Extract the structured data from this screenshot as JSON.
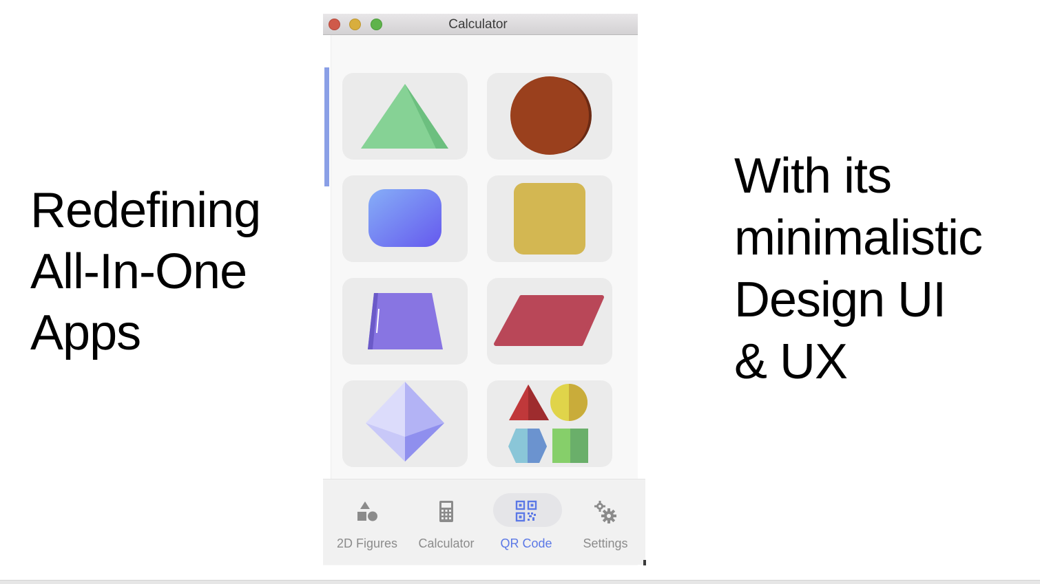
{
  "slide": {
    "left_heading": [
      "Redefining",
      "All-In-One",
      "Apps"
    ],
    "right_heading": [
      "With its",
      "minimalistic",
      "Design UI",
      "& UX"
    ]
  },
  "window": {
    "title": "Calculator",
    "traffic_lights": [
      "close",
      "minimize",
      "zoom"
    ]
  },
  "shapes": [
    {
      "name": "triangle-icon",
      "color": "#86d295"
    },
    {
      "name": "circle-icon",
      "color": "#9a401d"
    },
    {
      "name": "rounded-rectangle-icon",
      "color": "#6a74ee"
    },
    {
      "name": "square-icon",
      "color": "#d3b752"
    },
    {
      "name": "trapezoid-icon",
      "color": "#8875e2"
    },
    {
      "name": "parallelogram-icon",
      "color": "#b94758"
    },
    {
      "name": "rhombus-icon",
      "color": "#bfc0f7"
    },
    {
      "name": "shapes-collection-icon",
      "color": "#e0d44a"
    }
  ],
  "nav": {
    "items": [
      {
        "label": "2D Figures",
        "icon": "shapes-icon"
      },
      {
        "label": "Calculator",
        "icon": "calculator-icon"
      },
      {
        "label": "QR Code",
        "icon": "qr-code-icon",
        "active": true
      },
      {
        "label": "Settings",
        "icon": "gear-icon"
      }
    ],
    "active_color": "#5b78e6"
  }
}
